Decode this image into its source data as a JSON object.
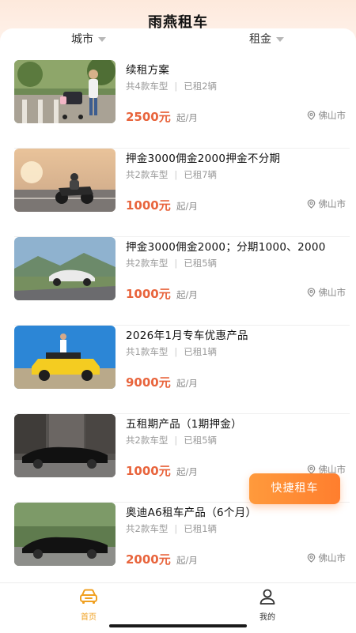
{
  "header": {
    "title": "雨燕租车"
  },
  "filters": {
    "city": "城市",
    "rent": "租金"
  },
  "items": [
    {
      "title": "续租方案",
      "models": "共4款车型",
      "rented": "已租2辆",
      "price": "2500元",
      "unit": "起/月",
      "city": "佛山市",
      "image": "family-stroller-park"
    },
    {
      "title": "押金3000佣金2000押金不分期",
      "models": "共2款车型",
      "rented": "已租7辆",
      "price": "1000元",
      "unit": "起/月",
      "city": "佛山市",
      "image": "motorcycle-rider-sunset"
    },
    {
      "title": "押金3000佣金2000；分期1000、2000",
      "models": "共2款车型",
      "rented": "已租5辆",
      "price": "1000元",
      "unit": "起/月",
      "city": "佛山市",
      "image": "white-sedan-mountain-road"
    },
    {
      "title": "2026年1月专车优惠产品",
      "models": "共1款车型",
      "rented": "已租1辆",
      "price": "9000元",
      "unit": "起/月",
      "city": "",
      "image": "yellow-jeep-blue-sky"
    },
    {
      "title": "五租期产品（1期押金）",
      "models": "共2款车型",
      "rented": "已租5辆",
      "price": "1000元",
      "unit": "起/月",
      "city": "佛山市",
      "image": "black-sedan-street"
    },
    {
      "title": "奥迪A6租车产品（6个月）",
      "models": "共2款车型",
      "rented": "已租1辆",
      "price": "2000元",
      "unit": "起/月",
      "city": "佛山市",
      "image": "black-audi-a6"
    }
  ],
  "separator": "|",
  "fab": {
    "label": "快捷租车"
  },
  "tabbar": {
    "home": "首页",
    "mine": "我的"
  },
  "colors": {
    "price": "#e8643c",
    "accent": "#ff8a34",
    "tab_active": "#f0a020"
  }
}
